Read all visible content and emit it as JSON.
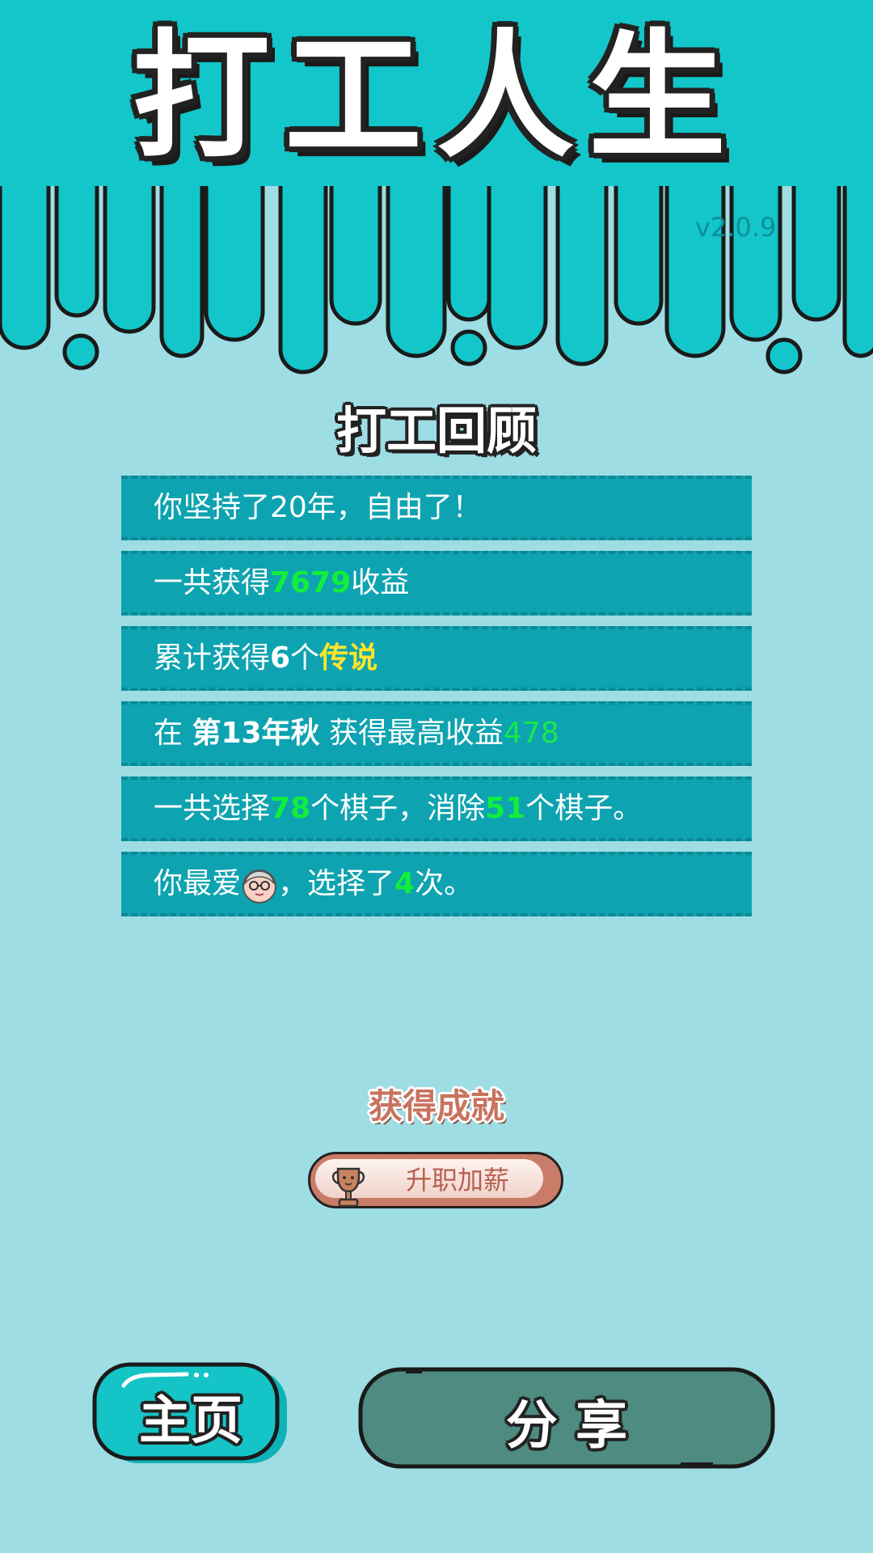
{
  "app": {
    "title": "打工人生",
    "version": "v2.0.9"
  },
  "summary": {
    "title": "打工回顾",
    "rows": [
      {
        "parts": [
          {
            "text": "你坚持了20年，自由了！"
          }
        ]
      },
      {
        "parts": [
          {
            "text": "一共获得"
          },
          {
            "text": "7679",
            "style": "hl-green"
          },
          {
            "text": "收益"
          }
        ]
      },
      {
        "parts": [
          {
            "text": "累计获得"
          },
          {
            "text": "6",
            "style": "hl-white-bold"
          },
          {
            "text": "个"
          },
          {
            "text": "传说",
            "style": "hl-yellow"
          }
        ]
      },
      {
        "parts": [
          {
            "text": "在 "
          },
          {
            "text": "第13年秋",
            "style": "hl-white-bold"
          },
          {
            "text": " 获得最高收益"
          },
          {
            "text": "478",
            "style": "hl-green-light"
          }
        ]
      },
      {
        "parts": [
          {
            "text": "一共选择"
          },
          {
            "text": "78",
            "style": "hl-green"
          },
          {
            "text": "个棋子，消除"
          },
          {
            "text": "51",
            "style": "hl-green"
          },
          {
            "text": "个棋子。"
          }
        ]
      },
      {
        "parts": [
          {
            "text": "你最爱"
          },
          {
            "icon": "old-man-avatar-icon"
          },
          {
            "text": "，选择了"
          },
          {
            "text": "4",
            "style": "hl-green"
          },
          {
            "text": "次。"
          }
        ]
      }
    ]
  },
  "achievement": {
    "title": "获得成就",
    "badge_label": "升职加薪",
    "badge_icon": "trophy-icon"
  },
  "buttons": {
    "home_label": "主页",
    "share_label": "分 享"
  },
  "colors": {
    "background": "#9fdde4",
    "header": "#12c6c9",
    "row": "#0ea3b0",
    "highlight_green": "#11ef3c",
    "highlight_yellow": "#ffe62a",
    "home_button": "#15c4c7",
    "share_button": "#4e8b80"
  }
}
